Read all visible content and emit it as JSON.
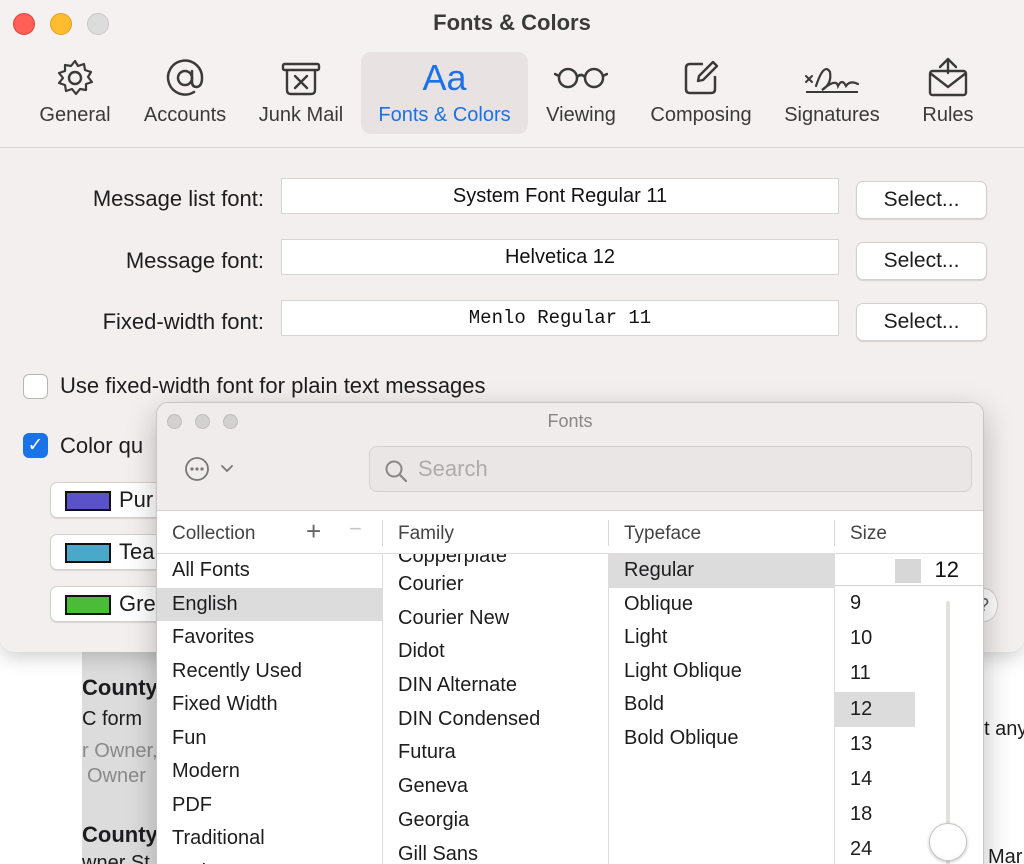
{
  "window": {
    "title": "Fonts & Colors"
  },
  "toolbar": {
    "items": [
      {
        "label": "General",
        "icon": "gear-icon"
      },
      {
        "label": "Accounts",
        "icon": "at-icon"
      },
      {
        "label": "Junk Mail",
        "icon": "junk-bin-icon"
      },
      {
        "label": "Fonts & Colors",
        "icon": "aa-icon",
        "active": true
      },
      {
        "label": "Viewing",
        "icon": "glasses-icon"
      },
      {
        "label": "Composing",
        "icon": "compose-icon"
      },
      {
        "label": "Signatures",
        "icon": "signature-icon"
      },
      {
        "label": "Rules",
        "icon": "rules-envelope-icon"
      }
    ],
    "aa_glyph": "Aa"
  },
  "fonts": {
    "message_list": {
      "label": "Message list font:",
      "value": "System Font Regular 11"
    },
    "message": {
      "label": "Message font:",
      "value": "Helvetica 12"
    },
    "fixed_width": {
      "label": "Fixed-width font:",
      "value": "Menlo Regular 11"
    },
    "select_label": "Select..."
  },
  "options": {
    "fixed_width_plain": {
      "label": "Use fixed-width font for plain text messages",
      "checked": false
    },
    "color_quoted": {
      "label": "Color qu",
      "checked": true
    }
  },
  "quote_colors": [
    {
      "label": "Pur",
      "color": "#5b52c9"
    },
    {
      "label": "Tea",
      "color": "#4aa9c9"
    },
    {
      "label": "Gre",
      "color": "#4cbb3a"
    }
  ],
  "fonts_panel": {
    "title": "Fonts",
    "search_placeholder": "Search",
    "headers": {
      "collection": "Collection",
      "family": "Family",
      "typeface": "Typeface",
      "size": "Size"
    },
    "collections": [
      "All Fonts",
      "English",
      "Favorites",
      "Recently Used",
      "Fixed Width",
      "Fun",
      "Modern",
      "PDF",
      "Traditional",
      "Web"
    ],
    "selected_collection": "English",
    "families_partial_top": "Copperplate",
    "families": [
      "Courier",
      "Courier New",
      "Didot",
      "DIN Alternate",
      "DIN Condensed",
      "Futura",
      "Geneva",
      "Georgia",
      "Gill Sans"
    ],
    "typefaces": [
      "Regular",
      "Oblique",
      "Light",
      "Light Oblique",
      "Bold",
      "Bold Oblique"
    ],
    "selected_typeface": "Regular",
    "size_value": "12",
    "sizes": [
      "9",
      "10",
      "11",
      "12",
      "13",
      "14",
      "18",
      "24"
    ],
    "selected_size": "12"
  },
  "background_doc": {
    "lines": [
      "County",
      "C form",
      "r Owner,",
      "Owner",
      "County",
      "wner St",
      "t any",
      "Mar"
    ]
  }
}
